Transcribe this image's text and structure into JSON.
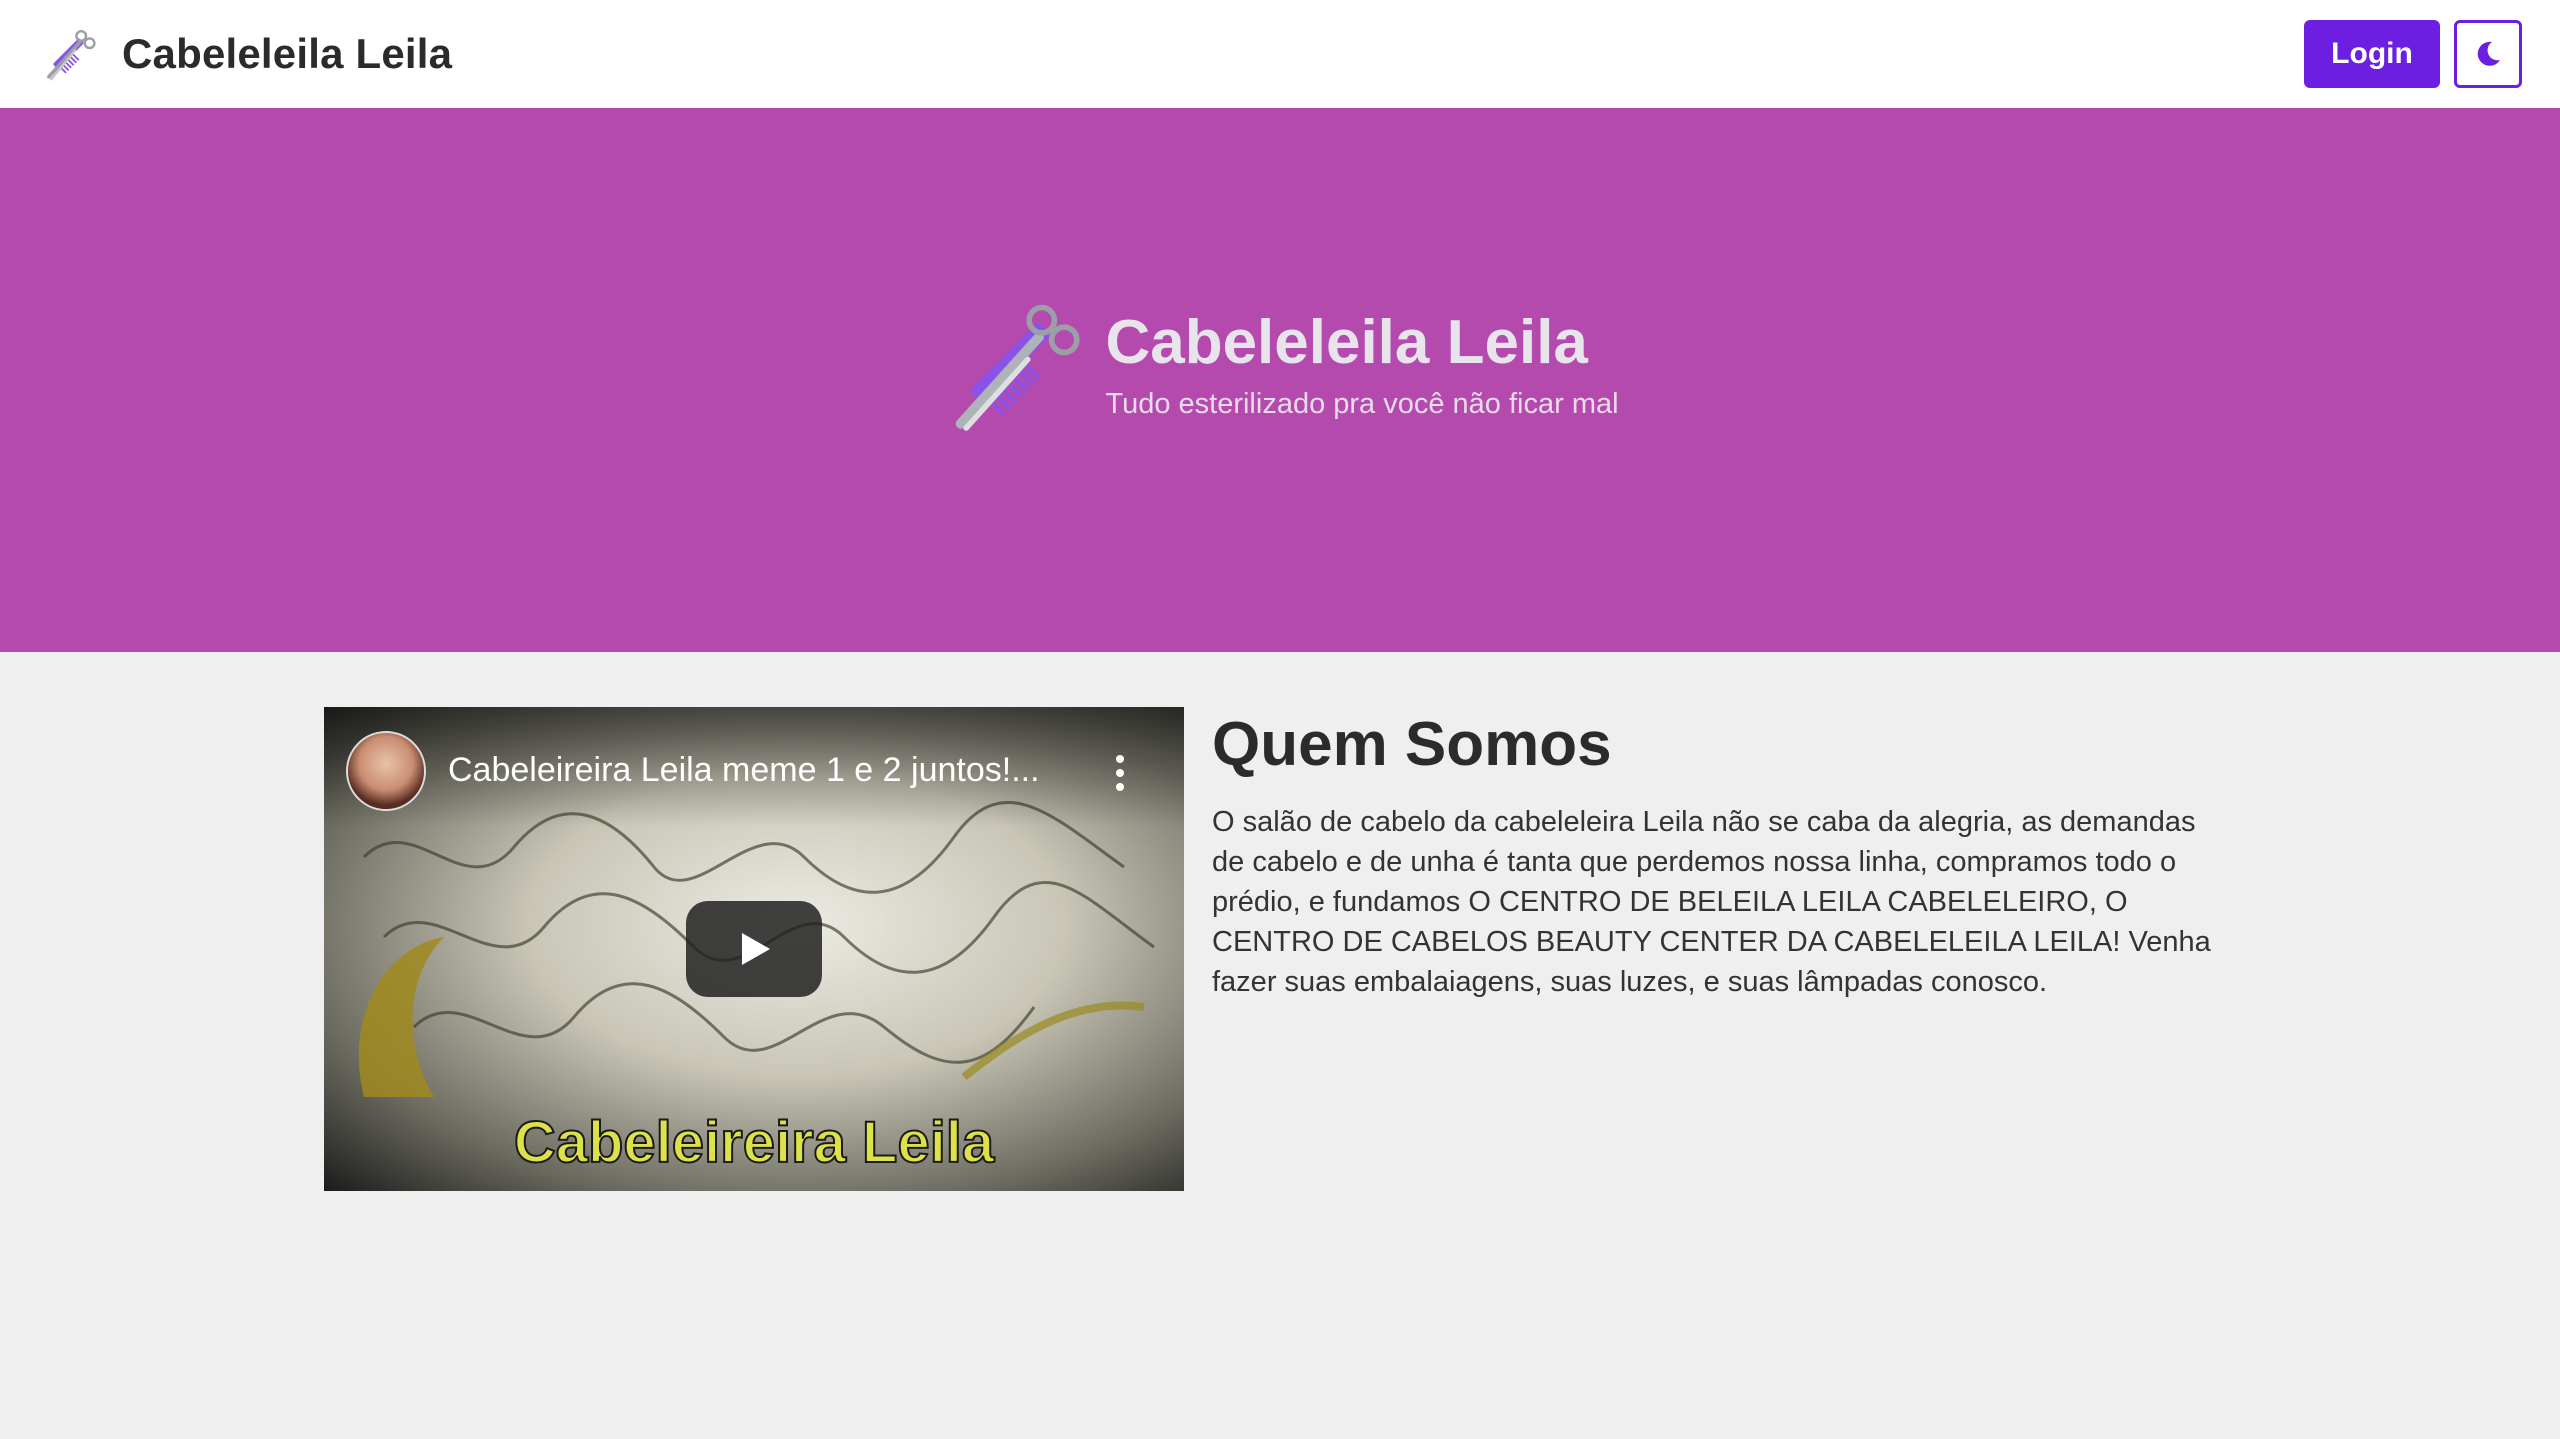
{
  "navbar": {
    "brand_title": "Cabeleleila Leila",
    "logo_icon": "comb-scissors-icon",
    "login_label": "Login",
    "theme_icon": "moon-icon"
  },
  "hero": {
    "title": "Cabeleleila Leila",
    "subtitle": "Tudo esterilizado pra você não ficar mal",
    "logo_icon": "comb-scissors-icon"
  },
  "video": {
    "title": "Cabeleireira Leila meme 1 e 2 juntos!...",
    "caption": "Cabeleireira Leila"
  },
  "about": {
    "title": "Quem Somos",
    "text": "O salão de cabelo da cabeleleira Leila não se caba da alegria, as demandas de cabelo e de unha é tanta que perdemos nossa linha, compramos todo o prédio, e fundamos O CENTRO DE BELEILA LEILA CABELELEIRO, O CENTRO DE CABELOS BEAUTY CENTER DA CABELELEILA LEILA! Venha fazer suas embalaiagens, suas luzes, e suas lâmpadas conosco."
  },
  "colors": {
    "accent": "#6c1fe0",
    "hero_bg": "#b54aae",
    "page_bg": "#efefef"
  }
}
